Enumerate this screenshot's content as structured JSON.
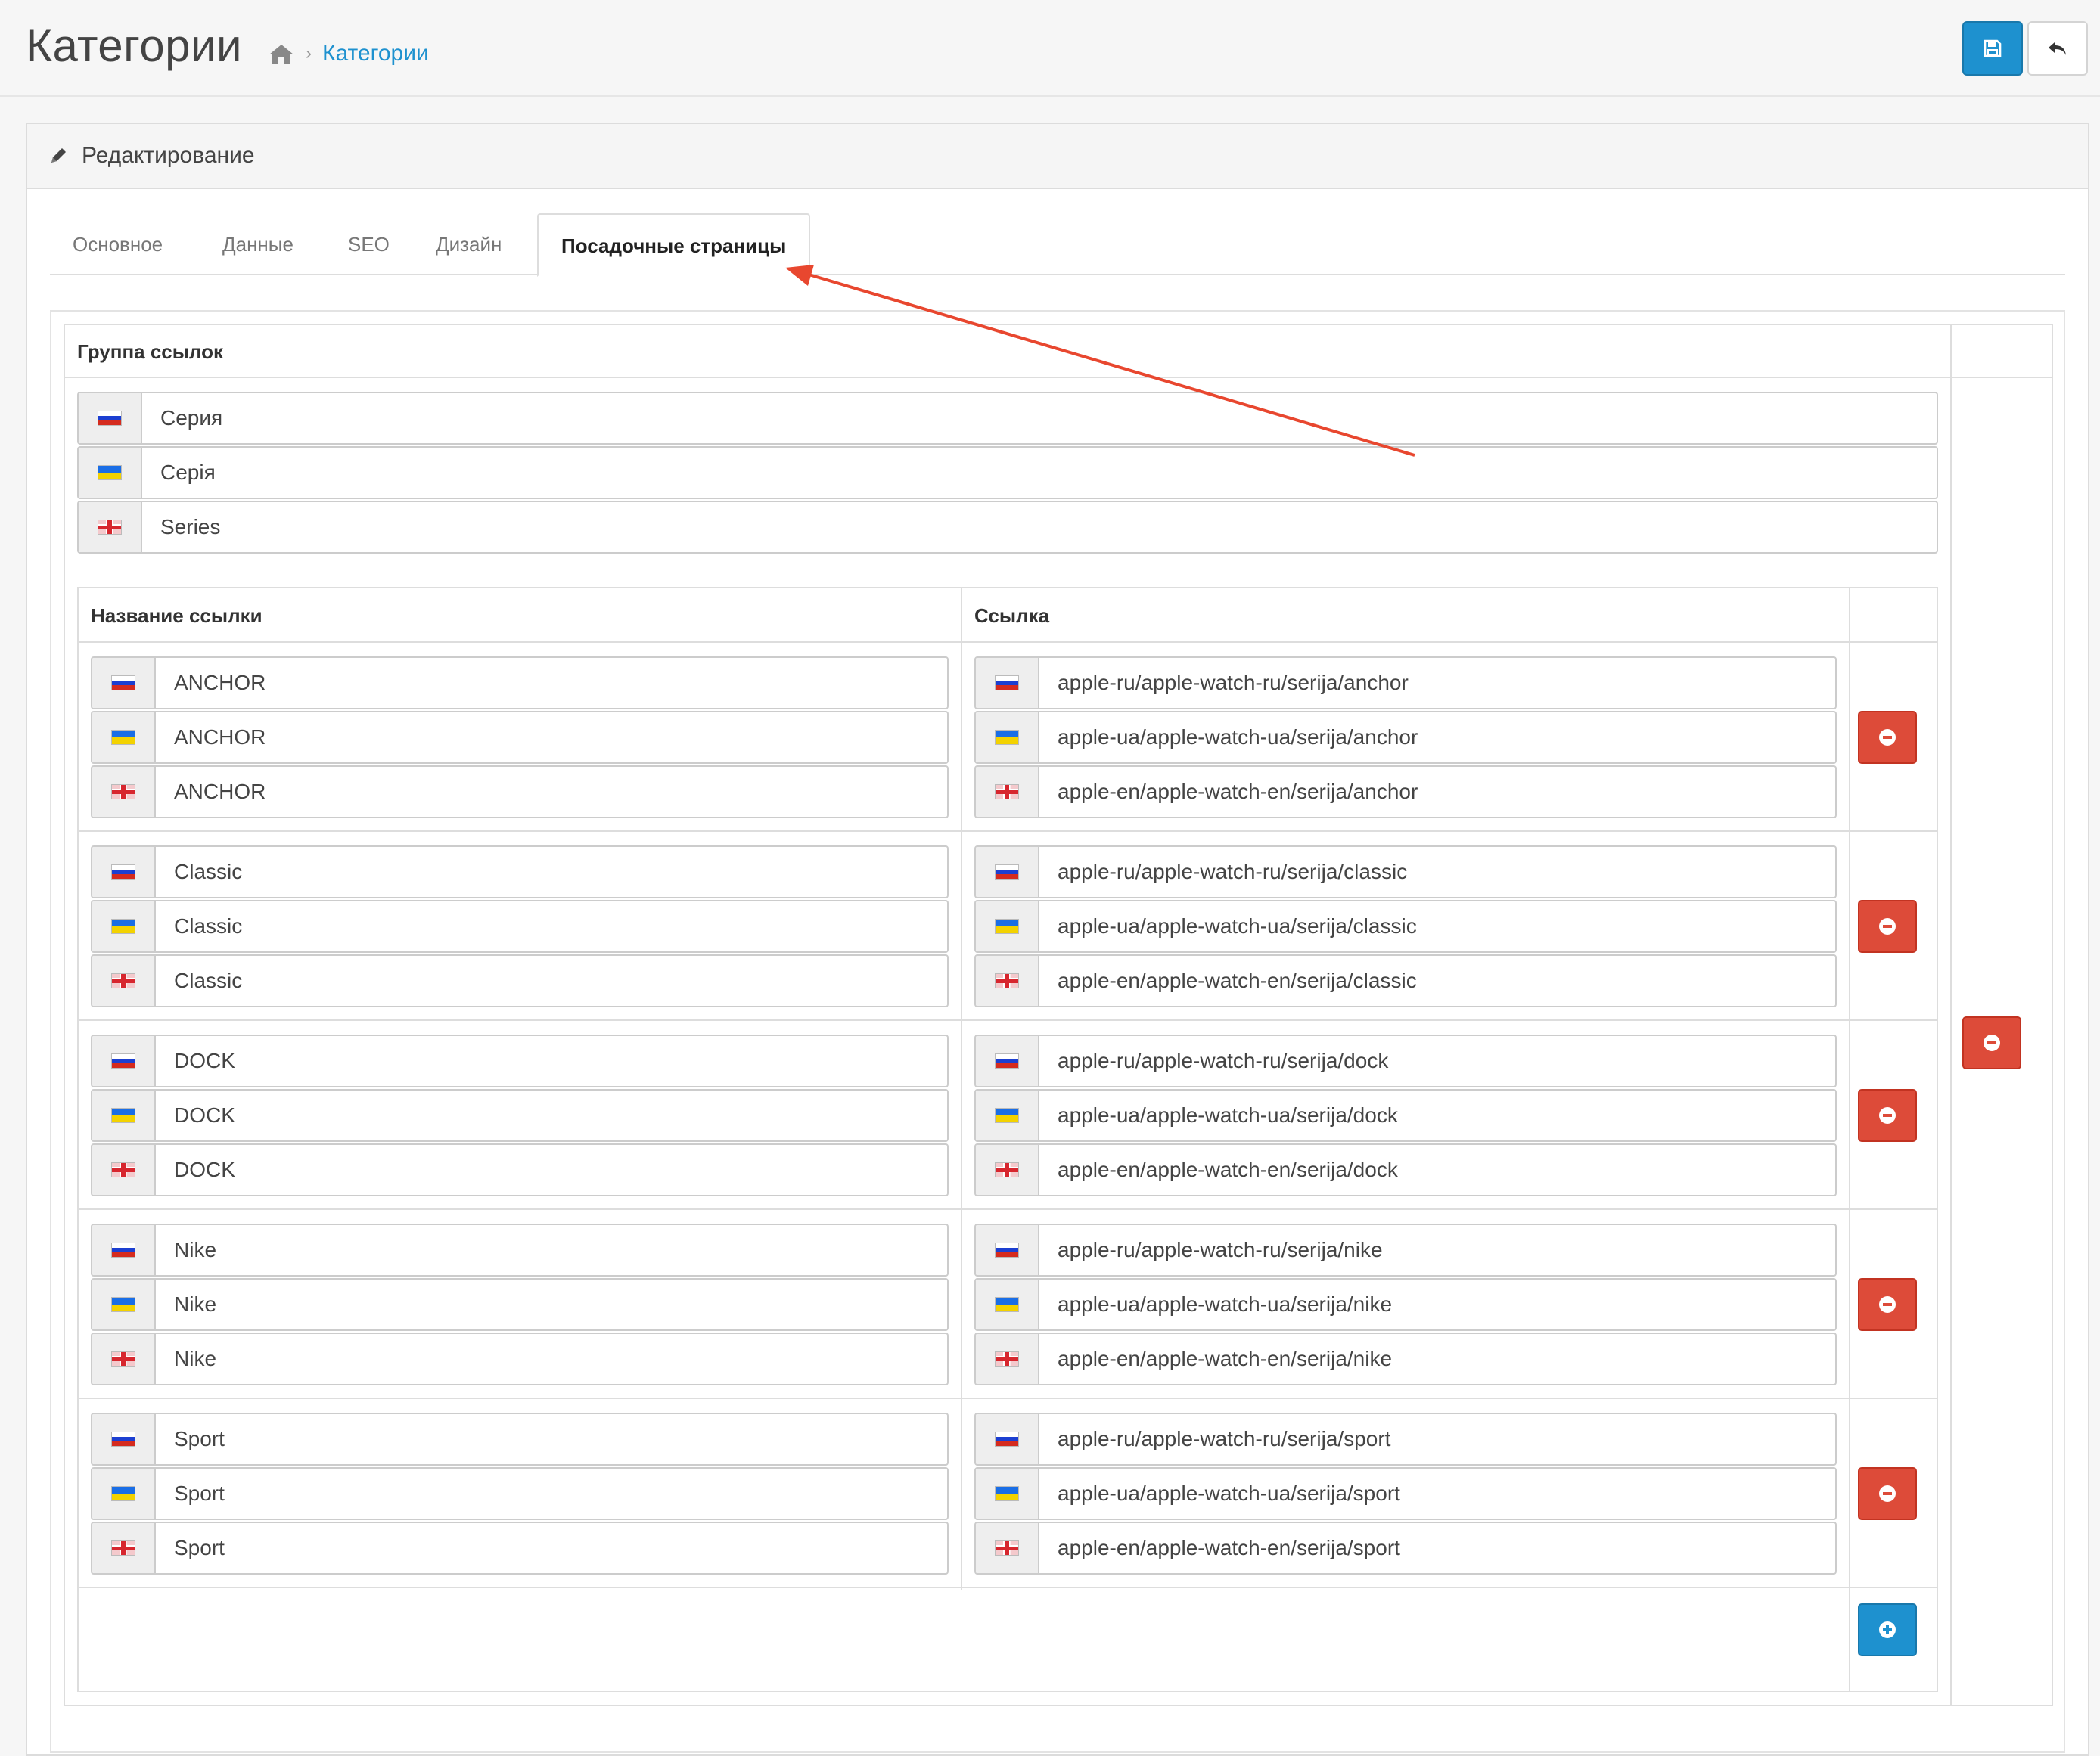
{
  "header": {
    "title": "Категории",
    "breadcrumb_sep": "›",
    "breadcrumb_link": "Категории",
    "save_icon": "save-icon",
    "back_icon": "reply-icon"
  },
  "panel": {
    "heading": "Редактирование",
    "heading_icon": "pencil-icon"
  },
  "tabs": [
    {
      "label": "Основное"
    },
    {
      "label": "Данные"
    },
    {
      "label": "SEO"
    },
    {
      "label": "Дизайн"
    },
    {
      "label": "Посадочные страницы",
      "active": true
    }
  ],
  "group": {
    "header": "Группа ссылок",
    "names": [
      {
        "lang": "ru",
        "value": "Серия"
      },
      {
        "lang": "ua",
        "value": "Серія"
      },
      {
        "lang": "en",
        "value": "Series"
      }
    ]
  },
  "links_table": {
    "col_name": "Название ссылки",
    "col_link": "Ссылка",
    "rows": [
      {
        "names": [
          "ANCHOR",
          "ANCHOR",
          "ANCHOR"
        ],
        "links": [
          "apple-ru/apple-watch-ru/serija/anchor",
          "apple-ua/apple-watch-ua/serija/anchor",
          "apple-en/apple-watch-en/serija/anchor"
        ]
      },
      {
        "names": [
          "Classic",
          "Classic",
          "Classic"
        ],
        "links": [
          "apple-ru/apple-watch-ru/serija/classic",
          "apple-ua/apple-watch-ua/serija/classic",
          "apple-en/apple-watch-en/serija/classic"
        ]
      },
      {
        "names": [
          "DOCK",
          "DOCK",
          "DOCK"
        ],
        "links": [
          "apple-ru/apple-watch-ru/serija/dock",
          "apple-ua/apple-watch-ua/serija/dock",
          "apple-en/apple-watch-en/serija/dock"
        ]
      },
      {
        "names": [
          "Nike",
          "Nike",
          "Nike"
        ],
        "links": [
          "apple-ru/apple-watch-ru/serija/nike",
          "apple-ua/apple-watch-ua/serija/nike",
          "apple-en/apple-watch-en/serija/nike"
        ]
      },
      {
        "names": [
          "Sport",
          "Sport",
          "Sport"
        ],
        "links": [
          "apple-ru/apple-watch-ru/serija/sport",
          "apple-ua/apple-watch-ua/serija/sport",
          "apple-en/apple-watch-en/serija/sport"
        ]
      }
    ]
  },
  "flag_icons": [
    "flag-ru-icon",
    "flag-ua-icon",
    "flag-en-icon"
  ],
  "colors": {
    "primary": "#1e91cf",
    "danger": "#dd4b39",
    "arrow": "#e8472f"
  }
}
